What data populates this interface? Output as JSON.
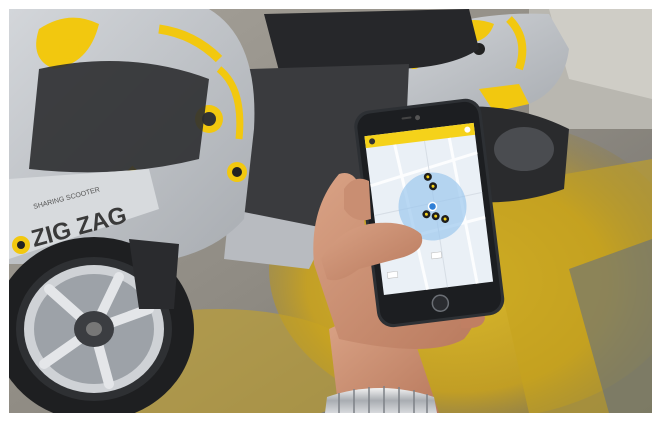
{
  "photo": {
    "scooter": {
      "brand_text": "ZIG ZAG",
      "small_text": "SHARING SCOOTER",
      "accent_color": "#f2c80f",
      "body_color": "#c9ccd0"
    },
    "phone": {
      "app_header_color": "#f5d21a",
      "map_bg_color": "#eaf0f6",
      "radius_color": "#9cc8ee",
      "marker_icon": "scooter-marker-icon"
    },
    "ground": {
      "paint_color": "#d8b21a",
      "concrete_color": "#8d8a84"
    }
  }
}
